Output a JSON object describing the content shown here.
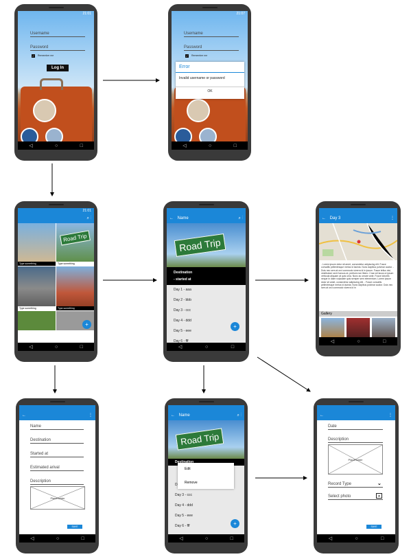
{
  "login": {
    "status_time": "21:01",
    "username_label": "Username",
    "password_label": "Password",
    "remember_label": "Remember me",
    "login_button": "Log In"
  },
  "error": {
    "status_time": "21:07",
    "username_label": "Username",
    "password_label": "Password",
    "remember_label": "Remember me",
    "dialog_title": "Error",
    "dialog_message": "Invalid username or password",
    "dialog_ok": "OK"
  },
  "gallery": {
    "status_time": "21:01",
    "captions": [
      "Type something",
      "Type something",
      "Type something",
      "Type something"
    ]
  },
  "trip": {
    "title": "Name",
    "banner": "Road Trip",
    "header_line1": "Destination",
    "header_line2": "- started at",
    "days": [
      "Day 1 - aaa",
      "Day 2 - bbb",
      "Day 3 - ccc",
      "Day 4 - ddd",
      "Day 5 - eee",
      "Day 6 - fff"
    ],
    "fab": "+"
  },
  "day": {
    "title": "Day 3",
    "text": "- Lorem ipsum dolor sit amet, consectetur adipiscing elit. Fusce convallis pellentesque metus id lacinia. Nunc dapibus pulvinar auctor. - Duis nec sem at orci commodo viverra id in ipsum. Fusce tellus nisi, vestibulum sed rhoncus at, pretium non libero. Cras vel lacus ut ipsum vehicula aliquam at quis urna. Nunc ac ornare ante. Fusce lobortis neque in diam vulputate quis semper sem elementum. Lorem ipsum dolor sit amet, consectetur adipiscing elit. - Fusce convallis pellentesque metus id lacinia. Nunc dapibus pulvinar auctor. Duis nec sem at orci commodo viverra id in",
    "gallery_label": "Gallery"
  },
  "newtrip": {
    "fields": [
      "Name",
      "Destination",
      "Started at",
      "Estimated arival",
      "Description"
    ],
    "placeholder": "Placeholder",
    "save": "SAVE"
  },
  "context": {
    "title": "Name",
    "banner": "Road Trip",
    "header_line1": "Destination",
    "menu_edit": "Edit",
    "menu_remove": "Remove",
    "days": [
      "Day 2 - bbb",
      "Day 3 - ccc",
      "Day 4 - ddd",
      "Day 5 - eee",
      "Day 6 - fff"
    ],
    "fab": "+"
  },
  "newday": {
    "date_label": "Date",
    "description_label": "Description",
    "placeholder": "Placeholder",
    "record_type": "Record Type",
    "select_photo": "Select photo",
    "save": "SAVE"
  },
  "nav": {
    "back": "◁",
    "home": "○",
    "recent": "□"
  }
}
